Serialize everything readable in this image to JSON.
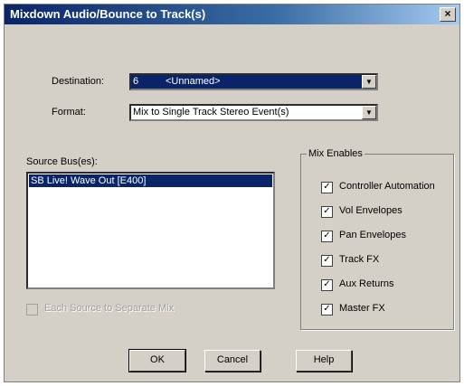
{
  "window": {
    "title": "Mixdown Audio/Bounce to Track(s)",
    "close_glyph": "×"
  },
  "destination": {
    "label": "Destination:",
    "value_num": "6",
    "value_text": "<Unnamed>"
  },
  "format": {
    "label": "Format:",
    "value": "Mix to Single Track Stereo Event(s)"
  },
  "source": {
    "label": "Source Bus(es):",
    "items": [
      "SB Live! Wave Out [E400]"
    ]
  },
  "each_source": {
    "label": "Each Source to Separate Mix",
    "checked": false,
    "enabled": false
  },
  "mix_enables": {
    "label": "Mix Enables",
    "items": [
      {
        "label": "Controller Automation",
        "checked": true
      },
      {
        "label": "Vol Envelopes",
        "checked": true
      },
      {
        "label": "Pan Envelopes",
        "checked": true
      },
      {
        "label": "Track FX",
        "checked": true
      },
      {
        "label": "Aux Returns",
        "checked": true
      },
      {
        "label": "Master FX",
        "checked": true
      }
    ]
  },
  "buttons": {
    "ok": "OK",
    "cancel": "Cancel",
    "help": "Help"
  },
  "glyphs": {
    "check": "✓",
    "dropdown": "▼"
  }
}
